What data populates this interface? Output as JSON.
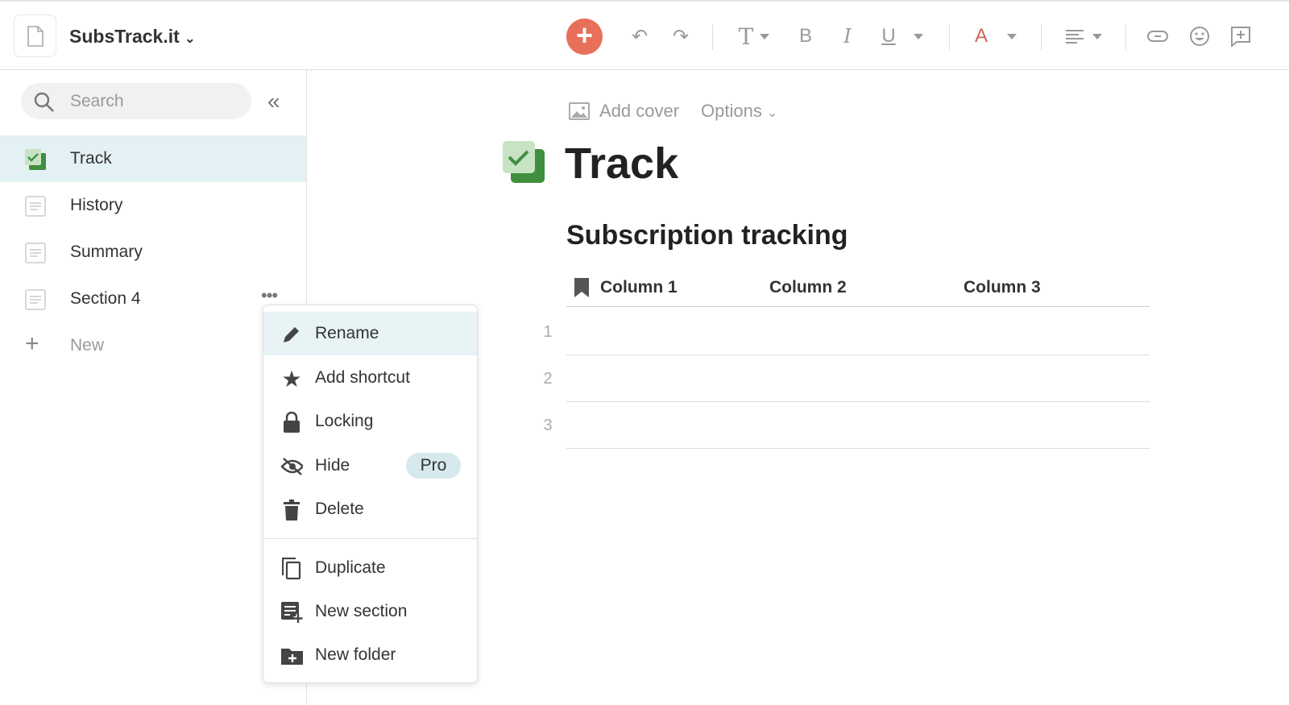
{
  "app": {
    "title": "SubsTrack.it"
  },
  "toolbar": {
    "icons": [
      "add-icon",
      "undo-icon",
      "redo-icon",
      "text-style-icon",
      "bold-icon",
      "italic-icon",
      "underline-icon",
      "font-color-icon",
      "align-icon",
      "link-icon",
      "emoji-icon",
      "comment-icon"
    ],
    "text_label": "T",
    "bold_label": "B",
    "italic_label": "I",
    "underline_label": "U",
    "color_label": "A",
    "accent": "#e86f5a",
    "font_color": "#d0665a"
  },
  "sidebar": {
    "search_placeholder": "Search",
    "items": [
      {
        "label": "Track",
        "active": true
      },
      {
        "label": "History"
      },
      {
        "label": "Summary"
      },
      {
        "label": "Section 4"
      }
    ],
    "new_label": "New",
    "active_bg": "#e3f0f4"
  },
  "context_menu": {
    "items": [
      {
        "label": "Rename"
      },
      {
        "label": "Add shortcut"
      },
      {
        "label": "Locking"
      },
      {
        "label": "Hide",
        "badge": "Pro"
      },
      {
        "label": "Delete"
      },
      {
        "label": "Duplicate"
      },
      {
        "label": "New section"
      },
      {
        "label": "New folder"
      }
    ]
  },
  "page": {
    "add_cover": "Add cover",
    "options": "Options",
    "title": "Track",
    "heading": "Subscription tracking",
    "table": {
      "columns": [
        "Column 1",
        "Column 2",
        "Column 3"
      ],
      "rows": [
        "1",
        "2",
        "3"
      ]
    }
  }
}
